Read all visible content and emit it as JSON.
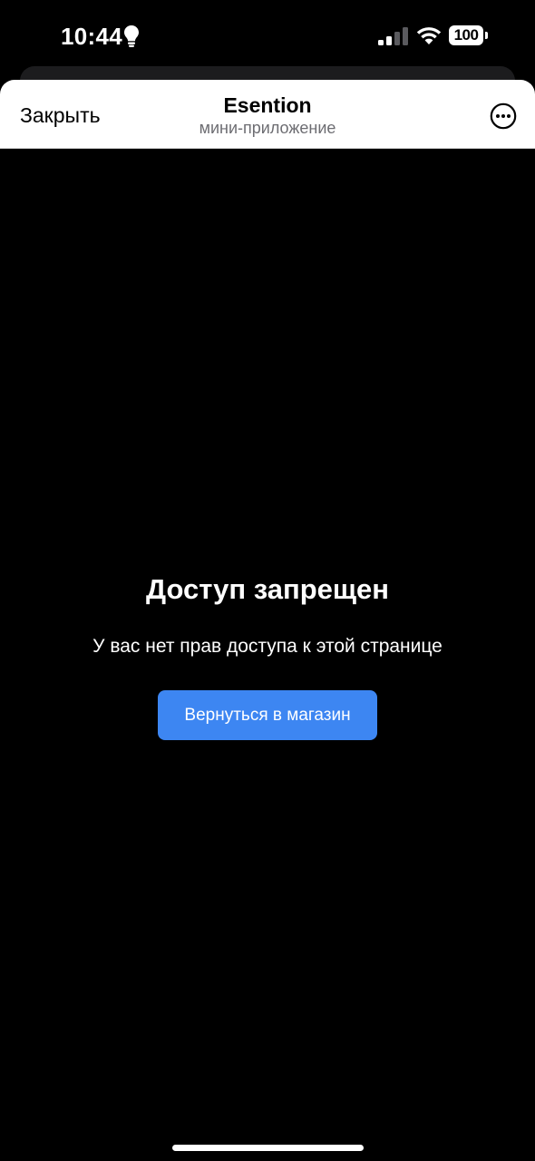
{
  "status_bar": {
    "time": "10:44",
    "battery": "100",
    "icons": [
      "lightbulb-icon",
      "cellular-signal-icon",
      "wifi-icon",
      "battery-icon"
    ]
  },
  "header": {
    "close_label": "Закрыть",
    "title": "Esention",
    "subtitle": "мини-приложение",
    "more_icon": "more-horizontal-circle-icon"
  },
  "content": {
    "title": "Доступ запрещен",
    "message": "У вас нет прав доступа к этой странице",
    "button_label": "Вернуться в магазин",
    "button_color": "#3d86f2"
  },
  "colors": {
    "background": "#000000",
    "header_background": "#ffffff",
    "subtitle": "#6d6d72"
  }
}
